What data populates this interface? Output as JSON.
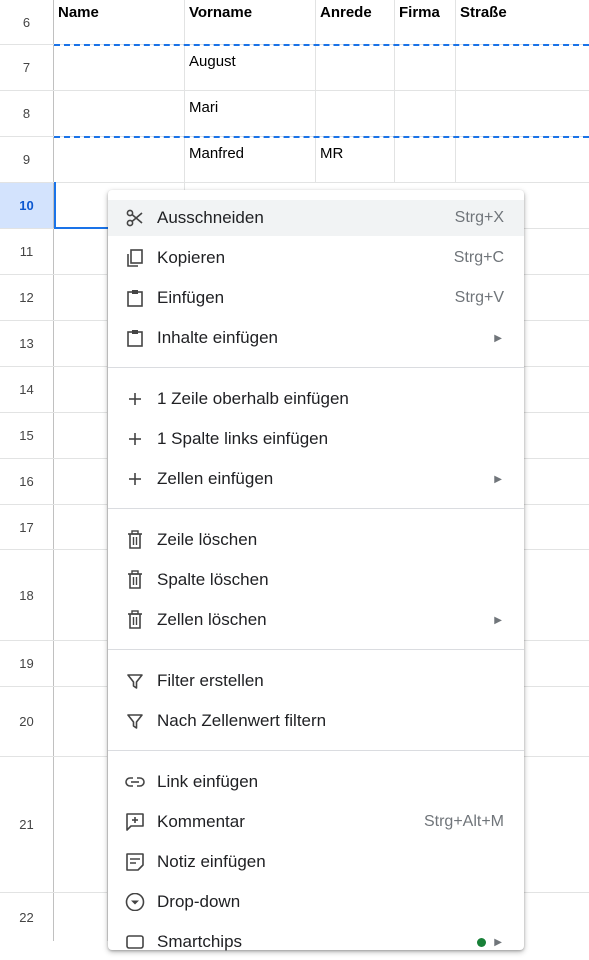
{
  "headers": [
    "Name",
    "Vorname",
    "Anrede",
    "Firma",
    "Straße"
  ],
  "rows": {
    "r6": "6",
    "r7": "7",
    "r8": "8",
    "r9": "9",
    "r10": "10",
    "r11": "11",
    "r12": "12",
    "r13": "13",
    "r14": "14",
    "r15": "15",
    "r16": "16",
    "r17": "17",
    "r18": "18",
    "r19": "19",
    "r20": "20",
    "r21": "21",
    "r22": "22"
  },
  "cells": {
    "r7_vorname": "August",
    "r8_vorname": "Mari",
    "r9_vorname": "Manfred",
    "r9_anrede": "MR"
  },
  "menu": {
    "cut": {
      "label": "Ausschneiden",
      "shortcut": "Strg+X",
      "icon": "scissors-icon"
    },
    "copy": {
      "label": "Kopieren",
      "shortcut": "Strg+C",
      "icon": "copy-icon"
    },
    "paste": {
      "label": "Einfügen",
      "shortcut": "Strg+V",
      "icon": "clipboard-icon"
    },
    "paste_special": {
      "label": "Inhalte einfügen",
      "icon": "clipboard-icon"
    },
    "insert_row_above": {
      "label": "1 Zeile oberhalb einfügen",
      "icon": "plus-icon"
    },
    "insert_col_left": {
      "label": "1 Spalte links einfügen",
      "icon": "plus-icon"
    },
    "insert_cells": {
      "label": "Zellen einfügen",
      "icon": "plus-icon"
    },
    "delete_row": {
      "label": "Zeile löschen",
      "icon": "trash-icon"
    },
    "delete_col": {
      "label": "Spalte löschen",
      "icon": "trash-icon"
    },
    "delete_cells": {
      "label": "Zellen löschen",
      "icon": "trash-icon"
    },
    "create_filter": {
      "label": "Filter erstellen",
      "icon": "filter-icon"
    },
    "filter_by_value": {
      "label": "Nach Zellenwert filtern",
      "icon": "filter-icon"
    },
    "insert_link": {
      "label": "Link einfügen",
      "icon": "link-icon"
    },
    "comment": {
      "label": "Kommentar",
      "shortcut": "Strg+Alt+M",
      "icon": "comment-add-icon"
    },
    "note": {
      "label": "Notiz einfügen",
      "icon": "note-icon"
    },
    "dropdown": {
      "label": "Drop-down",
      "icon": "dropdown-icon"
    },
    "smartchips": {
      "label": "Smartchips",
      "icon": "smartchip-icon"
    }
  },
  "colors": {
    "accent": "#1a73e8",
    "active_row_bg": "#d3e3fd",
    "hover_bg": "#f1f3f4"
  }
}
